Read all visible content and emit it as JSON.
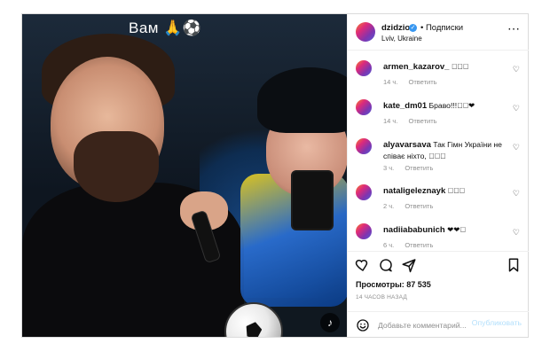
{
  "video": {
    "caption": "Вам 🙏⚽",
    "sound_icon": "volume-icon"
  },
  "header": {
    "username": "dzidzio",
    "verified_icon": "verified-badge-icon",
    "follow_label": "• Подписки",
    "location": "Lviv, Ukraine",
    "more_icon": "more-options-icon"
  },
  "comments": [
    {
      "user": "armen_kazarov_",
      "text": "􏿽􏿽􏿽",
      "time": "14 ч.",
      "reply": "Ответить"
    },
    {
      "user": "kate_dm01",
      "text": "Браво!!!􏿽􏿽❤",
      "time": "14 ч.",
      "reply": "Ответить"
    },
    {
      "user": "alyavarsava",
      "text": "Так Гімн України не співає ніхто, 􏿽􏿽􏿽",
      "time": "3 ч.",
      "reply": "Ответить"
    },
    {
      "user": "nataligeleznayk",
      "text": "􏿽􏿽􏿽",
      "time": "2 ч.",
      "reply": "Ответить"
    },
    {
      "user": "nadiiababunich",
      "text": "❤❤􏿽",
      "time": "6 ч.",
      "reply": "Ответить"
    }
  ],
  "actions": {
    "like_icon": "heart-icon",
    "comment_icon": "comment-icon",
    "share_icon": "paper-plane-icon",
    "save_icon": "bookmark-icon"
  },
  "stats": {
    "views": "Просмотры: 87 535",
    "posted": "14 ЧАСОВ НАЗАД"
  },
  "composer": {
    "placeholder": "Добавьте комментарий...",
    "publish_label": "Опубликовать"
  },
  "colors": {
    "accent": "#3897f0",
    "publish_disabled": "#b2dffc",
    "text_muted": "#8e8e8e",
    "border": "#dbdbdb"
  }
}
